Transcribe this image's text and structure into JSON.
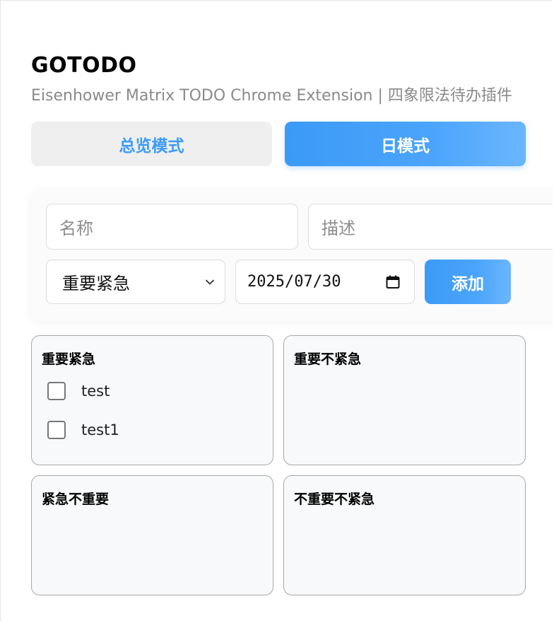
{
  "header": {
    "title": "GOTODO",
    "subtitle": "Eisenhower Matrix TODO Chrome Extension | 四象限法待办插件"
  },
  "modes": {
    "overview_label": "总览模式",
    "day_label": "日模式",
    "active": "day"
  },
  "form": {
    "name_placeholder": "名称",
    "desc_placeholder": "描述",
    "priority_value": "重要紧急",
    "date_value": "2025/07/30",
    "add_label": "添加"
  },
  "quadrants": [
    {
      "title": "重要紧急",
      "tasks": [
        {
          "label": "test",
          "done": false
        },
        {
          "label": "test1",
          "done": false
        }
      ]
    },
    {
      "title": "重要不紧急",
      "tasks": []
    },
    {
      "title": "紧急不重要",
      "tasks": []
    },
    {
      "title": "不重要不紧急",
      "tasks": []
    }
  ],
  "colors": {
    "accent": "#3b9af7",
    "accent_light": "#6ab6fd",
    "inactive_bg": "#efefef"
  }
}
